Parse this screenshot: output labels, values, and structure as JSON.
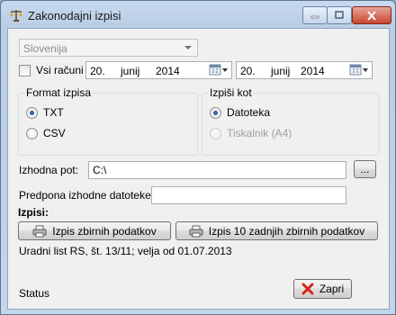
{
  "window": {
    "title": "Zakonodajni izpisi"
  },
  "region": {
    "selected": "Slovenija"
  },
  "all_accounts_label": "Vsi računi",
  "date_from": {
    "day": "20.",
    "month": "junij",
    "year": "2014"
  },
  "date_to": {
    "day": "20.",
    "month": "junij",
    "year": "2014"
  },
  "format_group": {
    "legend": "Format izpisa",
    "options": [
      "TXT",
      "CSV"
    ]
  },
  "output_group": {
    "legend": "Izpiši kot",
    "options": [
      "Datoteka",
      "Tiskalnik (A4)"
    ]
  },
  "output_path": {
    "label": "Izhodna pot:",
    "value": "C:\\",
    "browse_label": "..."
  },
  "file_prefix": {
    "label": "Predpona izhodne datoteke:",
    "value": ""
  },
  "prints": {
    "heading": "Izpisi:",
    "collected_button": "Izpis zbirnih podatkov",
    "last10_button": "Izpis 10 zadnjih zbirnih podatkov"
  },
  "legal_note": "Uradni list RS, št. 13/11; velja od 01.07.2013",
  "status_text": "Status",
  "close_button": "Zapri",
  "colors": {
    "title_bar": "#c7d9ed",
    "close_red": "#c8462e",
    "client_bg": "#f0f0f0"
  },
  "icons": {
    "app": "scales-icon",
    "print": "printer-icon",
    "close": "red-x-icon",
    "calendar": "calendar-icon"
  }
}
